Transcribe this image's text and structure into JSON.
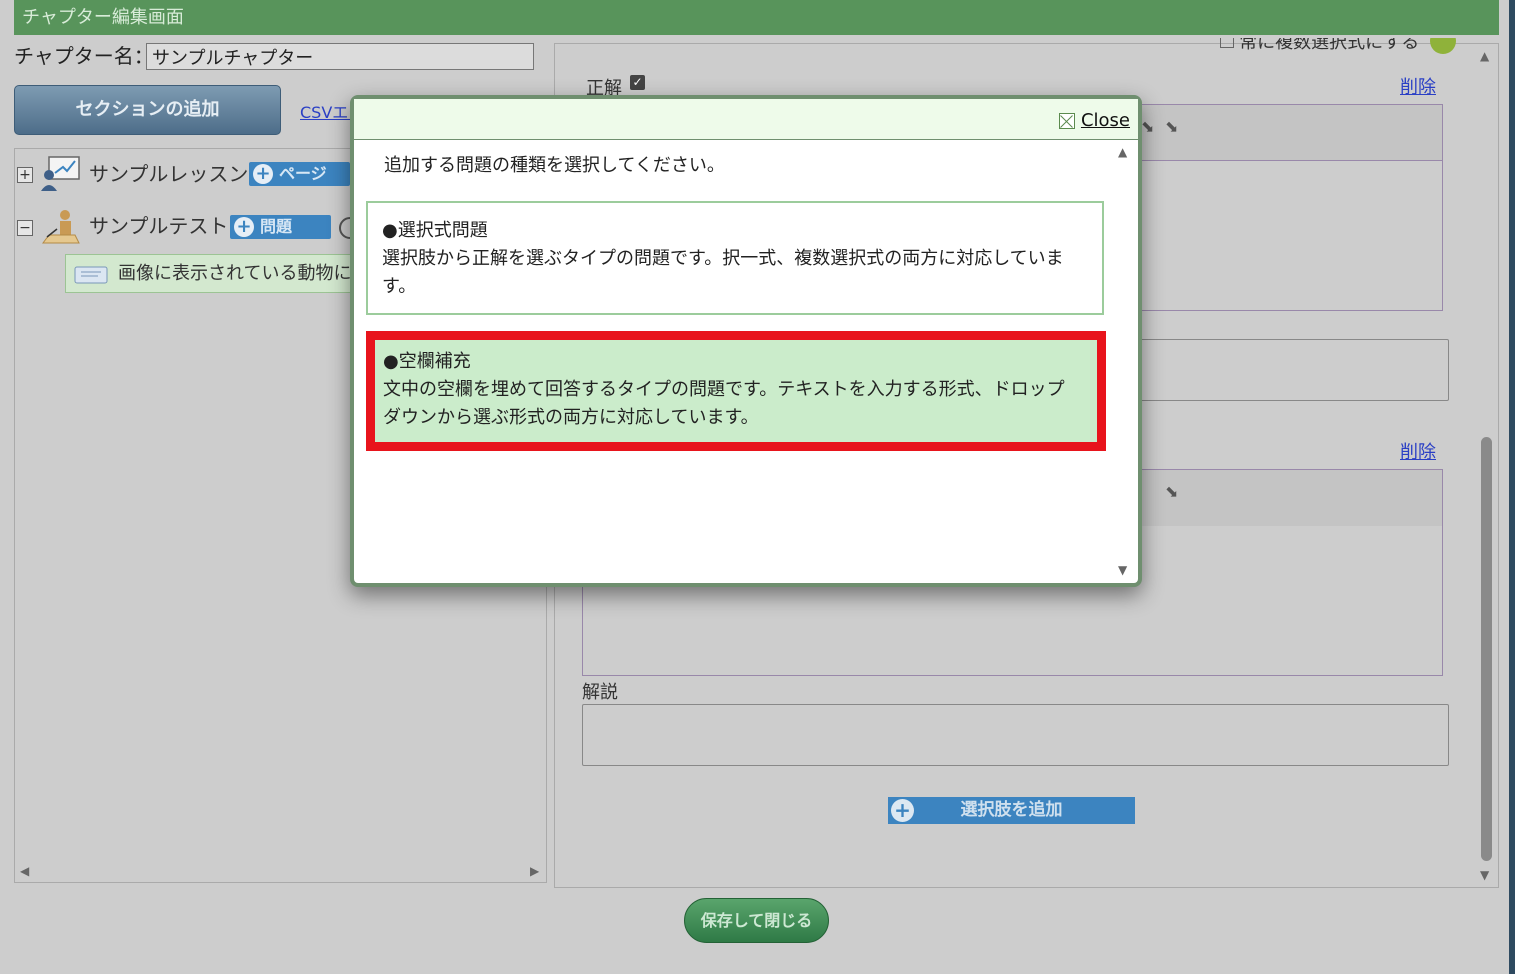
{
  "header": {
    "title": "チャプター編集画面"
  },
  "chapter": {
    "label": "チャプター名：",
    "name_value": "サンプルチャプター"
  },
  "toolbar": {
    "add_section_label": "セクションの追加",
    "csv_link_label": "CSVエク"
  },
  "tree": {
    "lesson": {
      "toggle": "+",
      "label": "サンプルレッスン",
      "add_button": "ページ"
    },
    "test": {
      "toggle": "−",
      "label": "サンプルテスト",
      "add_button": "問題"
    },
    "question_item": {
      "label": "画像に表示されている動物に"
    }
  },
  "editor": {
    "top_checkbox_label": "常に複数選択式にする",
    "correct_label": "正解",
    "delete_label_1": "削除",
    "delete_label_2": "削除",
    "explanation_label": "解説",
    "add_choice_label": "選択肢を追加"
  },
  "footer": {
    "save_close_label": "保存して閉じる"
  },
  "modal": {
    "close_label": "Close",
    "instruction": "追加する問題の種類を選択してください。",
    "question_types": [
      {
        "title": "●選択式問題",
        "description": "選択肢から正解を選ぶタイプの問題です。択一式、複数選択式の両方に対応しています。"
      },
      {
        "title": "●空欄補充",
        "description": "文中の空欄を埋めて回答するタイプの問題です。テキストを入力する形式、ドロップダウンから選ぶ形式の両方に対応しています。"
      }
    ]
  },
  "colors": {
    "header_bg": "#58945b",
    "highlight_border": "#e8141c",
    "highlight_bg": "#cbeccb",
    "button_blue": "#3c84c0",
    "save_green": "#2f7a46"
  }
}
